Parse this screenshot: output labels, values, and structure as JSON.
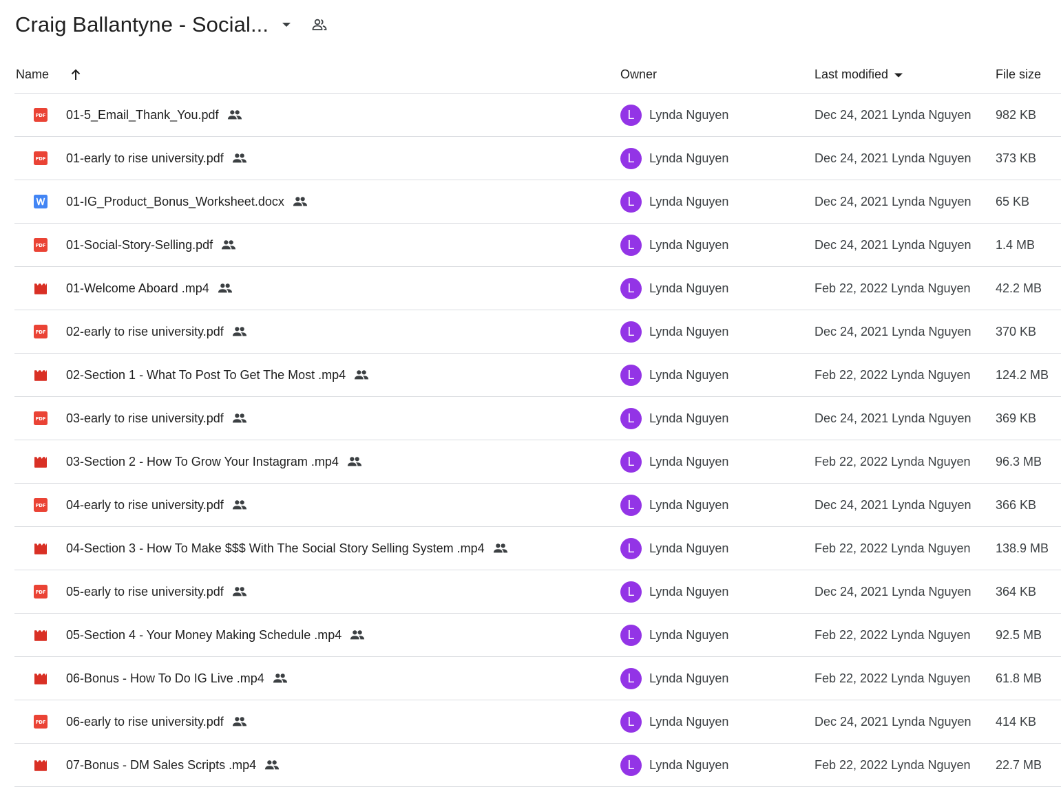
{
  "folder": {
    "title": "Craig Ballantyne - Social...",
    "title_caret_icon": "arrow-drop-down-icon",
    "shared_icon": "people-outline-icon"
  },
  "columns": {
    "name": "Name",
    "owner": "Owner",
    "last_modified": "Last modified",
    "file_size": "File size",
    "name_sort_icon": "arrow-upward-icon",
    "modified_sort_icon": "arrow-drop-down-icon"
  },
  "colors": {
    "pdf": "#ea4335",
    "word": "#4285f4",
    "video": "#d93025",
    "avatar": "#9334e6",
    "divider": "#dadce0"
  },
  "files": [
    {
      "name": "01-5_Email_Thank_You.pdf",
      "type": "pdf",
      "icon": "pdf-icon",
      "owner": "Lynda Nguyen",
      "owner_initial": "L",
      "modified": "Dec 24, 2021",
      "modified_by": "Lynda Nguyen",
      "size": "982 KB"
    },
    {
      "name": "01-early to rise university.pdf",
      "type": "pdf",
      "icon": "pdf-icon",
      "owner": "Lynda Nguyen",
      "owner_initial": "L",
      "modified": "Dec 24, 2021",
      "modified_by": "Lynda Nguyen",
      "size": "373 KB"
    },
    {
      "name": "01-IG_Product_Bonus_Worksheet.docx",
      "type": "word",
      "icon": "word-doc-icon",
      "owner": "Lynda Nguyen",
      "owner_initial": "L",
      "modified": "Dec 24, 2021",
      "modified_by": "Lynda Nguyen",
      "size": "65 KB"
    },
    {
      "name": "01-Social-Story-Selling.pdf",
      "type": "pdf",
      "icon": "pdf-icon",
      "owner": "Lynda Nguyen",
      "owner_initial": "L",
      "modified": "Dec 24, 2021",
      "modified_by": "Lynda Nguyen",
      "size": "1.4 MB"
    },
    {
      "name": "01-Welcome Aboard .mp4",
      "type": "video",
      "icon": "video-icon",
      "owner": "Lynda Nguyen",
      "owner_initial": "L",
      "modified": "Feb 22, 2022",
      "modified_by": "Lynda Nguyen",
      "size": "42.2 MB"
    },
    {
      "name": "02-early to rise university.pdf",
      "type": "pdf",
      "icon": "pdf-icon",
      "owner": "Lynda Nguyen",
      "owner_initial": "L",
      "modified": "Dec 24, 2021",
      "modified_by": "Lynda Nguyen",
      "size": "370 KB"
    },
    {
      "name": "02-Section 1 - What To Post To Get The Most .mp4",
      "type": "video",
      "icon": "video-icon",
      "owner": "Lynda Nguyen",
      "owner_initial": "L",
      "modified": "Feb 22, 2022",
      "modified_by": "Lynda Nguyen",
      "size": "124.2 MB"
    },
    {
      "name": "03-early to rise university.pdf",
      "type": "pdf",
      "icon": "pdf-icon",
      "owner": "Lynda Nguyen",
      "owner_initial": "L",
      "modified": "Dec 24, 2021",
      "modified_by": "Lynda Nguyen",
      "size": "369 KB"
    },
    {
      "name": "03-Section 2 - How To Grow Your Instagram .mp4",
      "type": "video",
      "icon": "video-icon",
      "owner": "Lynda Nguyen",
      "owner_initial": "L",
      "modified": "Feb 22, 2022",
      "modified_by": "Lynda Nguyen",
      "size": "96.3 MB"
    },
    {
      "name": "04-early to rise university.pdf",
      "type": "pdf",
      "icon": "pdf-icon",
      "owner": "Lynda Nguyen",
      "owner_initial": "L",
      "modified": "Dec 24, 2021",
      "modified_by": "Lynda Nguyen",
      "size": "366 KB"
    },
    {
      "name": "04-Section 3 - How To Make $$$ With The Social Story Selling System .mp4",
      "type": "video",
      "icon": "video-icon",
      "owner": "Lynda Nguyen",
      "owner_initial": "L",
      "modified": "Feb 22, 2022",
      "modified_by": "Lynda Nguyen",
      "size": "138.9 MB"
    },
    {
      "name": "05-early to rise university.pdf",
      "type": "pdf",
      "icon": "pdf-icon",
      "owner": "Lynda Nguyen",
      "owner_initial": "L",
      "modified": "Dec 24, 2021",
      "modified_by": "Lynda Nguyen",
      "size": "364 KB"
    },
    {
      "name": "05-Section 4 - Your Money Making Schedule .mp4",
      "type": "video",
      "icon": "video-icon",
      "owner": "Lynda Nguyen",
      "owner_initial": "L",
      "modified": "Feb 22, 2022",
      "modified_by": "Lynda Nguyen",
      "size": "92.5 MB"
    },
    {
      "name": "06-Bonus - How To Do IG Live .mp4",
      "type": "video",
      "icon": "video-icon",
      "owner": "Lynda Nguyen",
      "owner_initial": "L",
      "modified": "Feb 22, 2022",
      "modified_by": "Lynda Nguyen",
      "size": "61.8 MB"
    },
    {
      "name": "06-early to rise university.pdf",
      "type": "pdf",
      "icon": "pdf-icon",
      "owner": "Lynda Nguyen",
      "owner_initial": "L",
      "modified": "Dec 24, 2021",
      "modified_by": "Lynda Nguyen",
      "size": "414 KB"
    },
    {
      "name": "07-Bonus - DM Sales Scripts .mp4",
      "type": "video",
      "icon": "video-icon",
      "owner": "Lynda Nguyen",
      "owner_initial": "L",
      "modified": "Feb 22, 2022",
      "modified_by": "Lynda Nguyen",
      "size": "22.7 MB"
    }
  ]
}
